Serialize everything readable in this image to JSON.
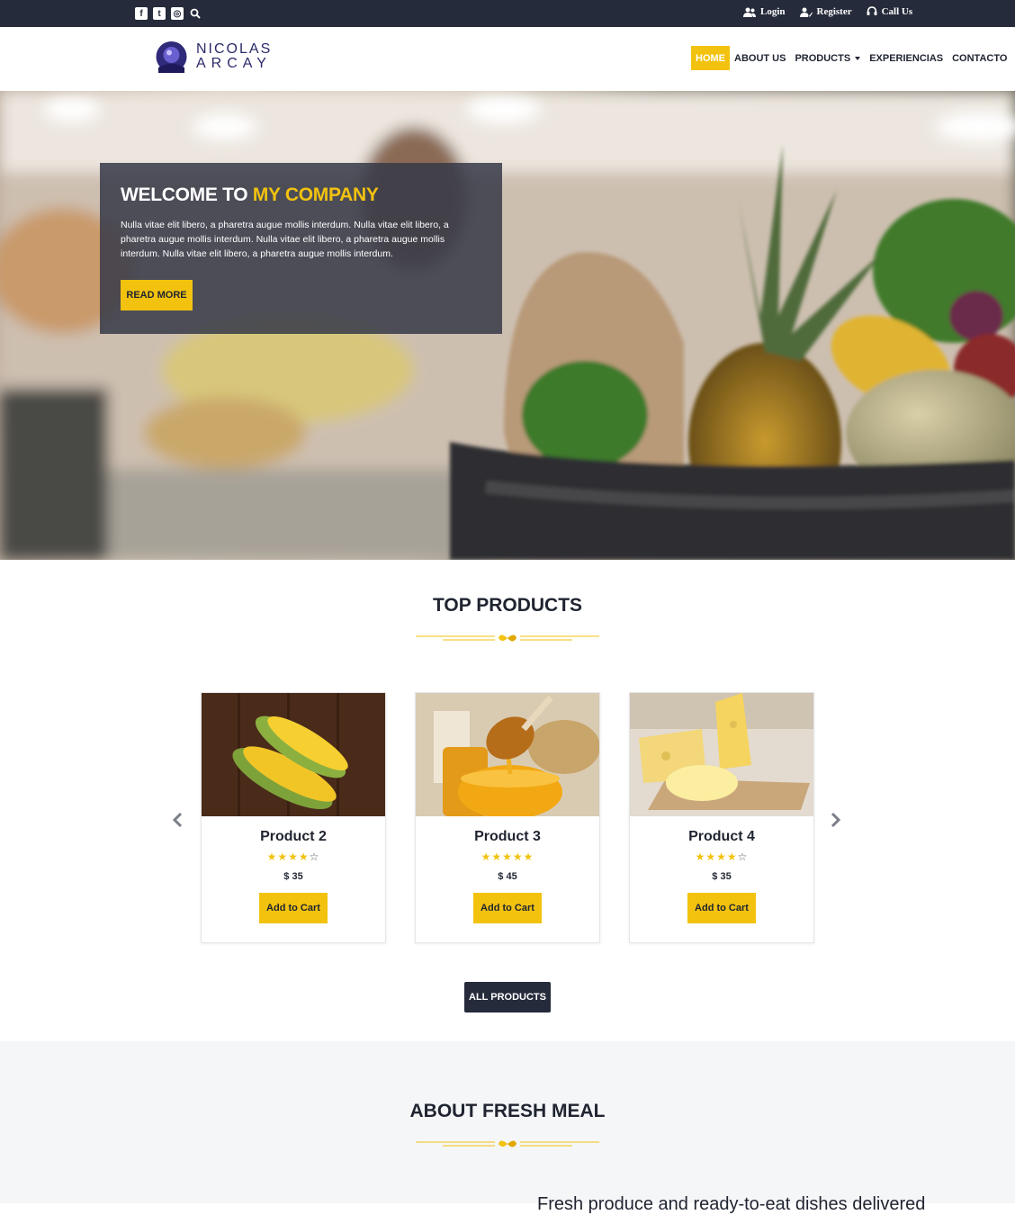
{
  "topbar": {
    "social": [
      {
        "icon": "facebook-icon",
        "glyph": "f"
      },
      {
        "icon": "twitter-icon",
        "glyph": "t"
      },
      {
        "icon": "instagram-icon",
        "glyph": "◎"
      }
    ],
    "search_icon": "search-icon",
    "links": [
      {
        "label": "Login",
        "icon": "users-icon"
      },
      {
        "label": "Register",
        "icon": "user-edit-icon"
      },
      {
        "label": "Call Us",
        "icon": "headset-icon"
      }
    ]
  },
  "header": {
    "logo_line1": "NICOLAS",
    "logo_line2": "ARCAY",
    "nav": [
      {
        "label": "HOME",
        "active": true
      },
      {
        "label": "ABOUT US"
      },
      {
        "label": "PRODUCTS",
        "dropdown": true
      },
      {
        "label": "EXPERIENCIAS"
      },
      {
        "label": "CONTACTO"
      }
    ]
  },
  "hero": {
    "title_part1": "WELCOME TO",
    "title_part2": "MY COMPANY",
    "text": "Nulla vitae elit libero, a pharetra augue mollis interdum. Nulla vitae elit libero, a pharetra augue mollis interdum. Nulla vitae elit libero, a pharetra augue mollis interdum. Nulla vitae elit libero, a pharetra augue mollis interdum.",
    "button": "READ MORE"
  },
  "products": {
    "title": "TOP PRODUCTS",
    "items": [
      {
        "name": "Product 2",
        "rating": 4,
        "price": "$ 35",
        "button": "Add to Cart"
      },
      {
        "name": "Product 3",
        "rating": 5,
        "price": "$ 45",
        "button": "Add to Cart"
      },
      {
        "name": "Product 4",
        "rating": 4,
        "price": "$ 35",
        "button": "Add to Cart"
      }
    ],
    "all_button": "ALL PRODUCTS"
  },
  "about": {
    "title": "ABOUT FRESH MEAL",
    "snippet": "Fresh produce and ready-to-eat dishes delivered"
  },
  "colors": {
    "accent": "#f2c20f",
    "dark": "#252b3b"
  }
}
